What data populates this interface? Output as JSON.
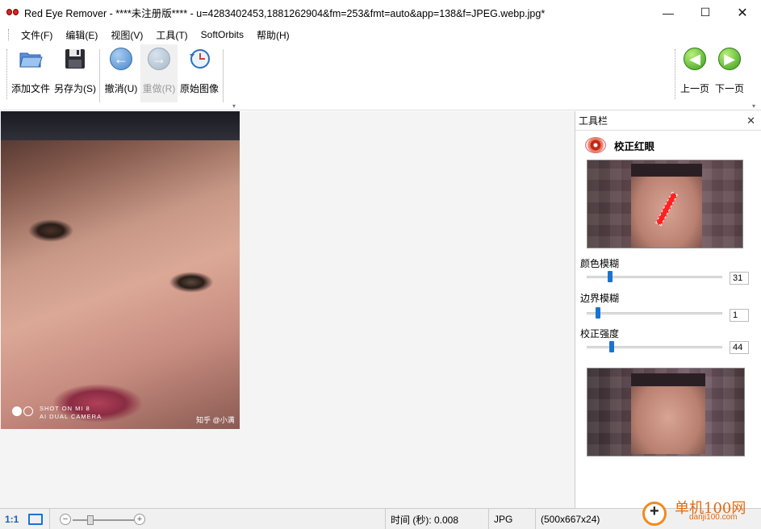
{
  "window": {
    "title": "Red Eye Remover - ****未注册版**** - u=4283402453,1881262904&fm=253&fmt=auto&app=138&f=JPEG.webp.jpg*",
    "minimize": "—",
    "maximize": "☐",
    "close": "✕"
  },
  "menu": [
    "文件(F)",
    "编辑(E)",
    "视图(V)",
    "工具(T)",
    "SoftOrbits",
    "帮助(H)"
  ],
  "toolbar": {
    "add_file": "添加文件",
    "save_as": "另存为(S)",
    "undo": "撤消(U)",
    "redo": "重做(R)",
    "original": "原始图像",
    "prev_page": "上一页",
    "next_page": "下一页"
  },
  "photo": {
    "watermark_line1": "SHOT ON MI 8",
    "watermark_line2": "AI DUAL CAMERA",
    "watermark_credit": "知乎 @小满"
  },
  "panel": {
    "header": "工具栏",
    "tool_name": "校正红眼",
    "sliders": [
      {
        "label": "颜色模糊",
        "value": "31",
        "fraction": 0.17
      },
      {
        "label": "边界模糊",
        "value": "1",
        "fraction": 0.08
      },
      {
        "label": "校正强度",
        "value": "44",
        "fraction": 0.18
      }
    ]
  },
  "status": {
    "zoom_label": "1:1",
    "time": "时间 (秒): 0.008",
    "format": "JPG",
    "dimensions": "(500x667x24)"
  },
  "site_watermark": {
    "title": "单机100网",
    "subtitle": "danji100.com"
  }
}
